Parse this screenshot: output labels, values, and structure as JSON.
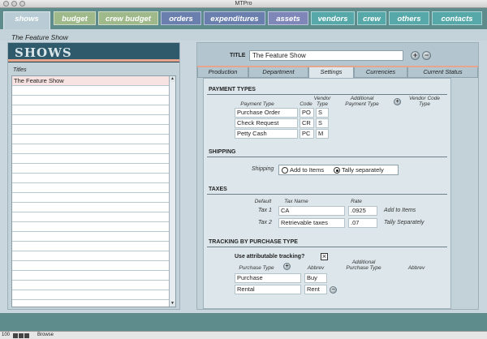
{
  "window": {
    "title": "MTPro"
  },
  "main_tabs": [
    {
      "label": "shows",
      "color": "#b9ccd6"
    },
    {
      "label": "budget",
      "color": "#9fb98a"
    },
    {
      "label": "crew budget",
      "color": "#9fb98a"
    },
    {
      "label": "orders",
      "color": "#6a7fae"
    },
    {
      "label": "expenditures",
      "color": "#6a7fae"
    },
    {
      "label": "assets",
      "color": "#7f86b8"
    },
    {
      "label": "vendors",
      "color": "#57a9a9"
    },
    {
      "label": "crew",
      "color": "#57a9a9"
    },
    {
      "label": "others",
      "color": "#57a9a9"
    },
    {
      "label": "contacts",
      "color": "#57a9a9"
    }
  ],
  "header": {
    "show_name": "The Feature Show"
  },
  "left": {
    "banner": "SHOWS",
    "titles_label": "Titles",
    "items": [
      "The Feature Show"
    ]
  },
  "right": {
    "title_label": "TITLE",
    "title_value": "The Feature Show",
    "add_glyph": "+",
    "remove_glyph": "−",
    "subtabs": [
      "Production",
      "Department",
      "Settings",
      "Currencies",
      "Current Status"
    ],
    "active_subtab": "Settings"
  },
  "payment": {
    "section": "PAYMENT TYPES",
    "col_payment_type": "Payment Type",
    "col_code": "Code",
    "col_vendor_type": "Vendor Type",
    "col_additional": "Additional Payment Type",
    "col_vendor_type2": "Vendor Code Type",
    "rows": [
      {
        "type": "Purchase Order",
        "code": "PO",
        "vtype": "S"
      },
      {
        "type": "Check Request",
        "code": "CR",
        "vtype": "S"
      },
      {
        "type": "Petty Cash",
        "code": "PC",
        "vtype": "M"
      }
    ]
  },
  "shipping": {
    "section": "SHIPPING",
    "label": "Shipping",
    "option_add": "Add to Items",
    "option_tally": "Tally separately",
    "selected": "tally"
  },
  "taxes": {
    "section": "TAXES",
    "col_default": "Default",
    "col_tax_name": "Tax Name",
    "col_rate": "Rate",
    "rows": [
      {
        "label": "Tax 1",
        "name": "CA",
        "rate": ".0925",
        "note": "Add to Items"
      },
      {
        "label": "Tax 2",
        "name": "Retrievable taxes",
        "rate": ".07",
        "note": "Tally Separately"
      }
    ]
  },
  "tracking": {
    "section": "TRACKING BY PURCHASE TYPE",
    "use_label": "Use attributable tracking?",
    "use_checked": true,
    "check_glyph": "×",
    "col_purchase_type": "Purchase Type",
    "col_abbrev": "Abbrev",
    "col_additional": "Additional Purchase Type",
    "col_abbrev2": "Abbrev",
    "rows": [
      {
        "type": "Purchase",
        "abbrev": "Buy"
      },
      {
        "type": "Rental",
        "abbrev": "Rent"
      }
    ]
  },
  "status": {
    "zoom": "100",
    "mode": "Browse"
  }
}
